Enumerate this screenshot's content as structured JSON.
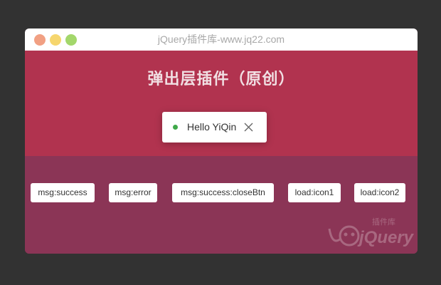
{
  "window": {
    "title": "jQuery插件库-www.jq22.com"
  },
  "hero": {
    "title": "弹出层插件（原创）"
  },
  "toast": {
    "text": "Hello YiQin",
    "status_color": "#3fa94a"
  },
  "buttons": [
    {
      "label": "msg:success"
    },
    {
      "label": "msg:error"
    },
    {
      "label": "msg:success:closeBtn"
    },
    {
      "label": "load:icon1"
    },
    {
      "label": "load:icon2"
    }
  ],
  "watermark": {
    "brand": "jQuery",
    "caption": "插件库"
  },
  "colors": {
    "backdrop": "#323232",
    "hero": "#b1334f",
    "lower": "#8b3556",
    "traffic_red": "#f1a083",
    "traffic_yellow": "#f6d66e",
    "traffic_green": "#a3d76b"
  },
  "icons": [
    "close-icon",
    "status-dot-icon",
    "jquery-logo"
  ]
}
